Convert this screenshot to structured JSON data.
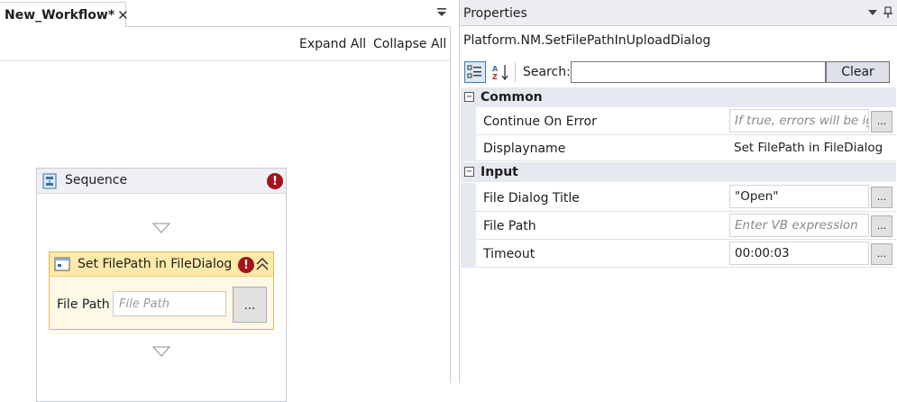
{
  "designer": {
    "tab_label": "New_Workflow*",
    "tab_close": "✕",
    "expand_all": "Expand All",
    "collapse_all": "Collapse All",
    "sequence": {
      "title": "Sequence",
      "error_mark": "!",
      "activity": {
        "title": "Set FilePath in FileDialog",
        "error_mark": "!",
        "file_path_label": "File Path",
        "file_path_placeholder": "File Path",
        "browse_label": "..."
      }
    }
  },
  "properties": {
    "title": "Properties",
    "activity_type": "Platform.NM.SetFilePathInUploadDialog",
    "search_label": "Search:",
    "search_value": "",
    "clear_label": "Clear",
    "alpha_sort_icon": "A↓",
    "categories": [
      {
        "label": "Common",
        "toggle": "−",
        "rows": [
          {
            "name": "Continue On Error",
            "value": "If true, errors will be ig",
            "hint": true,
            "browse": "..."
          },
          {
            "name": "Displayname",
            "value": "Set FilePath in FileDialog",
            "hint": false,
            "browse": ""
          }
        ]
      },
      {
        "label": "Input",
        "toggle": "−",
        "rows": [
          {
            "name": "File Dialog Title",
            "value": "\"Open\"",
            "hint": false,
            "browse": "..."
          },
          {
            "name": "File Path",
            "value": "Enter VB expression",
            "hint": true,
            "browse": "..."
          },
          {
            "name": "Timeout",
            "value": "00:00:03",
            "hint": false,
            "browse": "..."
          }
        ]
      }
    ]
  },
  "colors": {
    "error_red": "#a3141b",
    "activity_header": "#fde9a9",
    "activity_border": "#e6b84a",
    "category_bg": "#e6e9f0"
  }
}
